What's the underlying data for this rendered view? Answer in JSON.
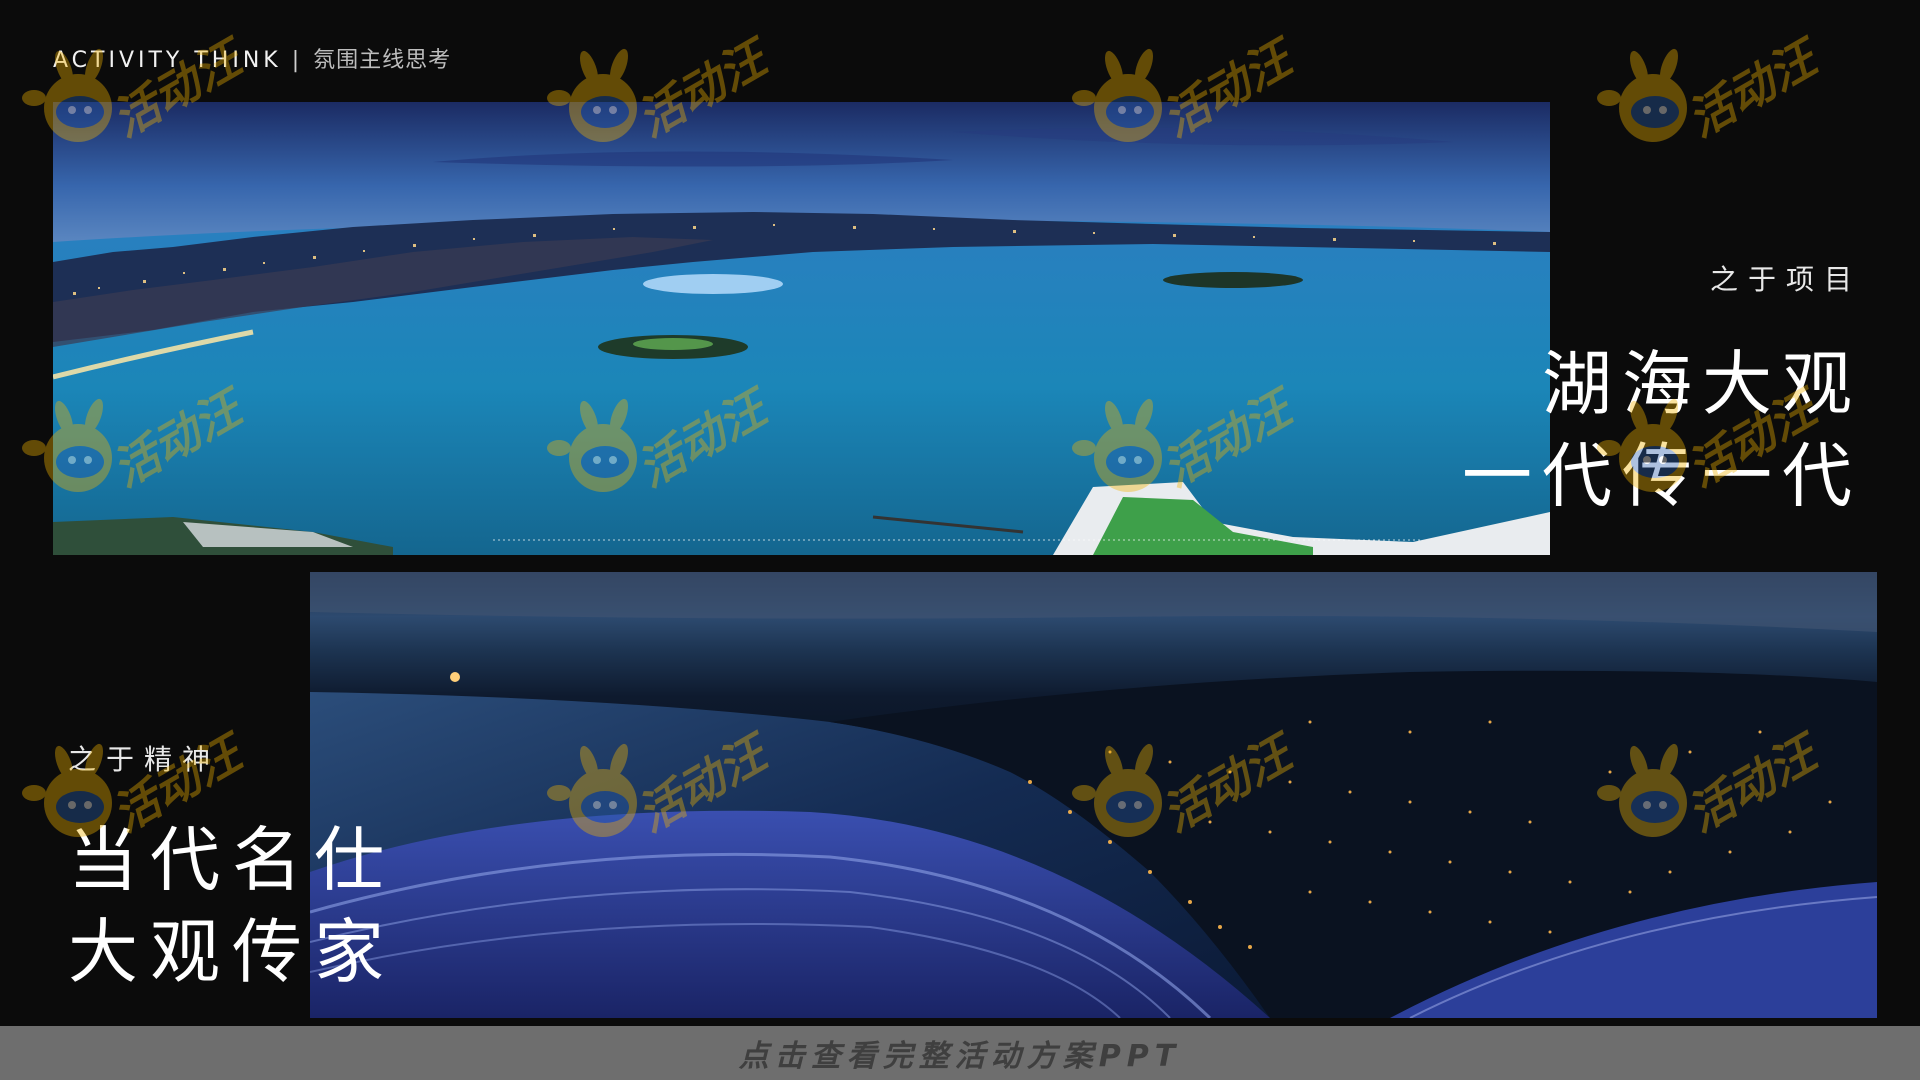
{
  "header": {
    "title_en": "ACTIVITY THINK",
    "separator": "|",
    "title_cn": "氛围主线思考"
  },
  "project_caption": {
    "kicker": "之于项目",
    "line1": "湖海大观",
    "line2": "一代传一代"
  },
  "spirit_caption": {
    "kicker": "之于精神",
    "line1": "当代名仕",
    "line2": "大观传家"
  },
  "watermark": {
    "text": "活动汪",
    "icon": "mascot-logo-icon"
  },
  "footer": {
    "cta": "点击查看完整活动方案PPT"
  },
  "colors": {
    "background": "#0b0b0b",
    "footer_bar": "#6e6e6e",
    "footer_text": "#3f3f3f",
    "watermark": "#f2b400",
    "lake_blue": "#1a86b8",
    "night_sky": "#1b2a45"
  }
}
